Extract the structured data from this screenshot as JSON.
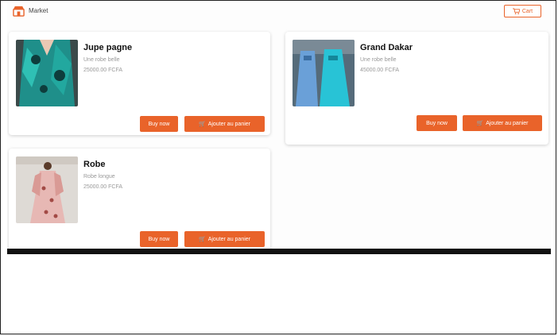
{
  "header": {
    "logo_text": "Market",
    "cart_label": "Cart"
  },
  "products": [
    {
      "name": "Jupe pagne",
      "description": "Une robe belle",
      "price": "25000.00 FCFA",
      "buy_label": "Buy now",
      "add_label": "Ajouter au panier"
    },
    {
      "name": "Grand Dakar",
      "description": "Une robe belle",
      "price": "45000.00 FCFA",
      "buy_label": "Buy now",
      "add_label": "Ajouter au panier"
    },
    {
      "name": "Robe",
      "description": "Robe longue",
      "price": "25000.00 FCFA",
      "buy_label": "Buy now",
      "add_label": "Ajouter au panier"
    }
  ],
  "colors": {
    "accent": "#e9632a",
    "background": "#fdfdfd",
    "card": "#ffffff"
  },
  "icons": {
    "logo": "shop-icon",
    "cart": "cart-icon",
    "add": "cart-plus-icon"
  }
}
